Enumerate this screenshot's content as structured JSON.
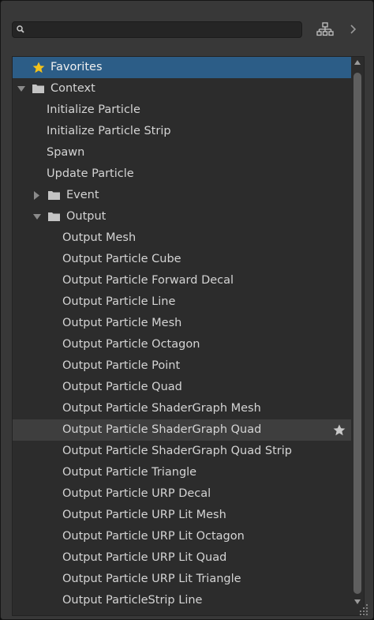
{
  "search": {
    "placeholder": "",
    "value": ""
  },
  "toolbar": {
    "hierarchy_icon": "hierarchy-icon",
    "collapse_icon": "chevron-right-icon"
  },
  "colors": {
    "selected": "#2c5d87",
    "favorite_star": "#f3c21b",
    "hover": "#3e3e3e"
  },
  "tree": {
    "favorites": "Favorites",
    "context": "Context",
    "initialize_particle": "Initialize Particle",
    "initialize_particle_strip": "Initialize Particle Strip",
    "spawn": "Spawn",
    "update_particle": "Update Particle",
    "event": "Event",
    "output": "Output",
    "outputs": [
      "Output Mesh",
      "Output Particle Cube",
      "Output Particle Forward Decal",
      "Output Particle Line",
      "Output Particle Mesh",
      "Output Particle Octagon",
      "Output Particle Point",
      "Output Particle Quad",
      "Output Particle ShaderGraph Mesh",
      "Output Particle ShaderGraph Quad",
      "Output Particle ShaderGraph Quad Strip",
      "Output Particle Triangle",
      "Output Particle URP Decal",
      "Output Particle URP Lit Mesh",
      "Output Particle URP Lit Octagon",
      "Output Particle URP Lit Quad",
      "Output Particle URP Lit Triangle",
      "Output ParticleStrip Line"
    ]
  }
}
